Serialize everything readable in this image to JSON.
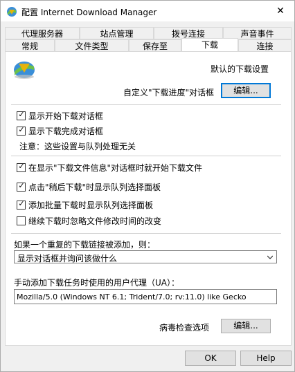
{
  "window": {
    "title": "配置 Internet Download Manager"
  },
  "tabs_row1": [
    "代理服务器",
    "站点管理",
    "拨号连接",
    "声音事件"
  ],
  "tabs_row2": [
    "常规",
    "文件类型",
    "保存至",
    "下载",
    "连接"
  ],
  "panel": {
    "heading": "默认的下载设置",
    "progress_dialog_label": "自定义\"下载进度\"对话框",
    "edit_button": "编辑...",
    "checkboxes": [
      {
        "label": "显示开始下载对话框",
        "checked": true
      },
      {
        "label": "显示下载完成对话框",
        "checked": true
      },
      {
        "label": "在显示\"下载文件信息\"对话框时就开始下载文件",
        "checked": true
      },
      {
        "label": "点击\"稍后下载\"时显示队列选择面板",
        "checked": true
      },
      {
        "label": "添加批量下载时显示队列选择面板",
        "checked": true
      },
      {
        "label": "继续下载时忽略文件修改时间的改变",
        "checked": false
      }
    ],
    "note": "注意：这些设置与队列处理无关",
    "duplicate_label": "如果一个重复的下载链接被添加，则：",
    "duplicate_value": "显示对话框并询问该做什么",
    "ua_label": "手动添加下载任务时使用的用户代理（UA）：",
    "ua_value": "Mozilla/5.0 (Windows NT 6.1; Trident/7.0; rv:11.0) like Gecko",
    "virus_label": "病毒检查选项",
    "virus_edit_button": "编辑..."
  },
  "footer": {
    "ok": "OK",
    "help": "Help"
  }
}
